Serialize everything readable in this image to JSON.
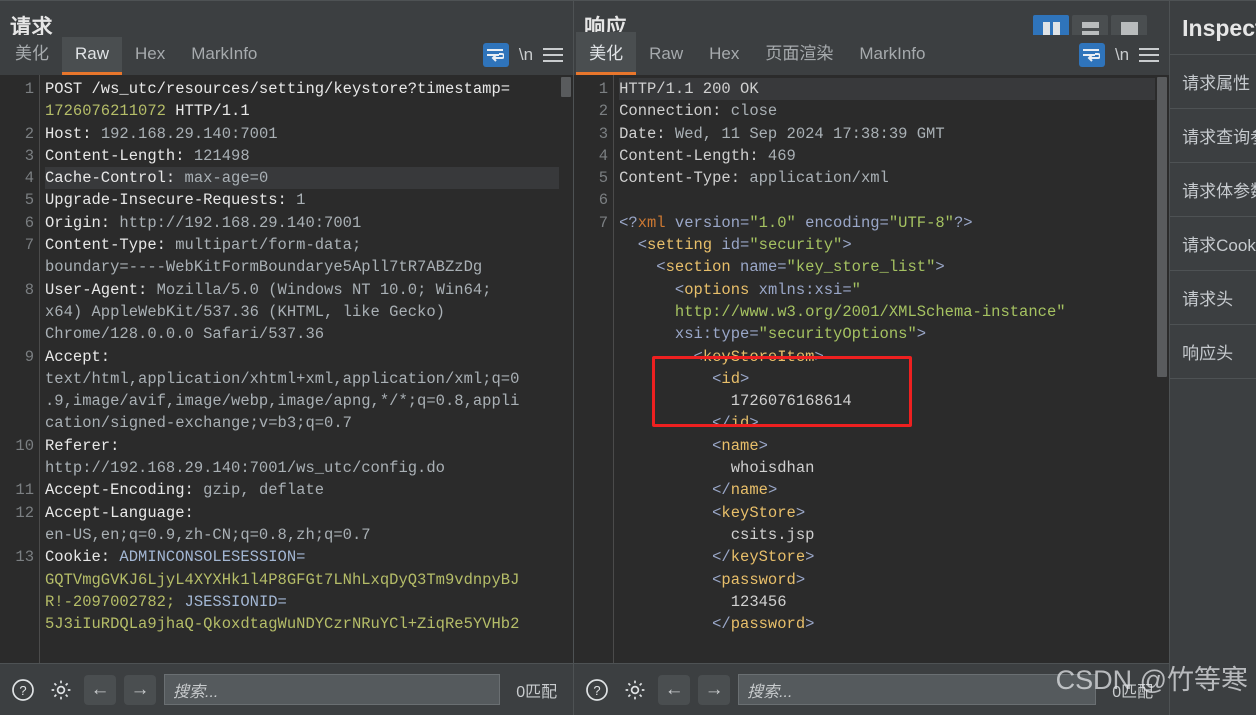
{
  "request": {
    "title": "请求",
    "tabs": [
      {
        "label": "美化",
        "active": false
      },
      {
        "label": "Raw",
        "active": true
      },
      {
        "label": "Hex",
        "active": false
      },
      {
        "label": "MarkInfo",
        "active": false
      }
    ],
    "tools": {
      "wrap": "word-wrap",
      "newline": "\\n",
      "menu": "menu"
    },
    "lines": [
      {
        "n": "1",
        "parts": [
          {
            "t": "POST /ws_utc/resources/setting/keystore?timestamp=",
            "c": "t-key"
          }
        ]
      },
      {
        "n": "",
        "parts": [
          {
            "t": "1726076211072",
            "c": "t-olive"
          },
          {
            "t": " HTTP/1.1",
            "c": "t-key"
          }
        ]
      },
      {
        "n": "2",
        "parts": [
          {
            "t": "Host: ",
            "c": "t-key"
          },
          {
            "t": "192.168.29.140:7001",
            "c": "t-val"
          }
        ]
      },
      {
        "n": "3",
        "parts": [
          {
            "t": "Content-Length: ",
            "c": "t-key"
          },
          {
            "t": "121498",
            "c": "t-val"
          }
        ]
      },
      {
        "n": "4",
        "hl": true,
        "parts": [
          {
            "t": "Cache-Control: ",
            "c": "t-key"
          },
          {
            "t": "max-age=0",
            "c": "t-val"
          }
        ]
      },
      {
        "n": "5",
        "parts": [
          {
            "t": "Upgrade-Insecure-Requests: ",
            "c": "t-key"
          },
          {
            "t": "1",
            "c": "t-val"
          }
        ]
      },
      {
        "n": "6",
        "parts": [
          {
            "t": "Origin: ",
            "c": "t-key"
          },
          {
            "t": "http://192.168.29.140:7001",
            "c": "t-val"
          }
        ]
      },
      {
        "n": "7",
        "parts": [
          {
            "t": "Content-Type: ",
            "c": "t-key"
          },
          {
            "t": "multipart/form-data;",
            "c": "t-val"
          }
        ]
      },
      {
        "n": "",
        "parts": [
          {
            "t": "boundary=----WebKitFormBoundarye5Apll7tR7ABZzDg",
            "c": "t-val"
          }
        ]
      },
      {
        "n": "8",
        "parts": [
          {
            "t": "User-Agent: ",
            "c": "t-key"
          },
          {
            "t": "Mozilla/5.0 (Windows NT 10.0; Win64;",
            "c": "t-val"
          }
        ]
      },
      {
        "n": "",
        "parts": [
          {
            "t": "x64) AppleWebKit/537.36 (KHTML, like Gecko)",
            "c": "t-val"
          }
        ]
      },
      {
        "n": "",
        "parts": [
          {
            "t": "Chrome/128.0.0.0 Safari/537.36",
            "c": "t-val"
          }
        ]
      },
      {
        "n": "9",
        "parts": [
          {
            "t": "Accept:",
            "c": "t-key"
          }
        ]
      },
      {
        "n": "",
        "parts": [
          {
            "t": "text/html,application/xhtml+xml,application/xml;q=0",
            "c": "t-val"
          }
        ]
      },
      {
        "n": "",
        "parts": [
          {
            "t": ".9,image/avif,image/webp,image/apng,*/*;q=0.8,appli",
            "c": "t-val"
          }
        ]
      },
      {
        "n": "",
        "parts": [
          {
            "t": "cation/signed-exchange;v=b3;q=0.7",
            "c": "t-val"
          }
        ]
      },
      {
        "n": "10",
        "parts": [
          {
            "t": "Referer:",
            "c": "t-key"
          }
        ]
      },
      {
        "n": "",
        "parts": [
          {
            "t": "http://192.168.29.140:7001/ws_utc/config.do",
            "c": "t-val"
          }
        ]
      },
      {
        "n": "11",
        "parts": [
          {
            "t": "Accept-Encoding: ",
            "c": "t-key"
          },
          {
            "t": "gzip, deflate",
            "c": "t-val"
          }
        ]
      },
      {
        "n": "12",
        "parts": [
          {
            "t": "Accept-Language:",
            "c": "t-key"
          }
        ]
      },
      {
        "n": "",
        "parts": [
          {
            "t": "en-US,en;q=0.9,zh-CN;q=0.8,zh;q=0.7",
            "c": "t-val"
          }
        ]
      },
      {
        "n": "13",
        "parts": [
          {
            "t": "Cookie: ",
            "c": "t-key"
          },
          {
            "t": "ADMINCONSOLESESSION=",
            "c": "t-blue"
          }
        ]
      },
      {
        "n": "",
        "parts": [
          {
            "t": "GQTVmgGVKJ6LjyL4XYXHk1l4P8GFGt7LNhLxqDyQ3Tm9vdnpyBJ",
            "c": "t-olive"
          }
        ]
      },
      {
        "n": "",
        "parts": [
          {
            "t": "R!-2097002782; ",
            "c": "t-olive"
          },
          {
            "t": "JSESSIONID=",
            "c": "t-blue"
          }
        ]
      },
      {
        "n": "",
        "parts": [
          {
            "t": "5J3iIuRDQLa9jhaQ-QkoxdtagWuNDYCzrNRuYCl+ZiqRe5YVHb2",
            "c": "t-olive"
          }
        ]
      }
    ],
    "findbar": {
      "help": "help-icon",
      "settings": "gear-icon",
      "prev": "←",
      "next": "→",
      "search_value": "",
      "search_placeholder": "搜索...",
      "match_count": "0匹配"
    }
  },
  "response": {
    "title": "响应",
    "tabs": [
      {
        "label": "美化",
        "active": true
      },
      {
        "label": "Raw",
        "active": false
      },
      {
        "label": "Hex",
        "active": false
      },
      {
        "label": "页面渲染",
        "active": false
      },
      {
        "label": "MarkInfo",
        "active": false
      }
    ],
    "tools": {
      "wrap": "word-wrap",
      "newline": "\\n",
      "menu": "menu"
    },
    "layout_toggles": [
      {
        "name": "vertical-split",
        "active": true
      },
      {
        "name": "horizontal-split",
        "active": false
      },
      {
        "name": "single-pane",
        "active": false
      }
    ],
    "lines": [
      {
        "n": "1",
        "hl": true,
        "parts": [
          {
            "t": "HTTP/1.1 200 OK",
            "c": "x-text"
          }
        ]
      },
      {
        "n": "2",
        "parts": [
          {
            "t": "Connection: ",
            "c": "x-text"
          },
          {
            "t": "close",
            "c": "t-val"
          }
        ]
      },
      {
        "n": "3",
        "parts": [
          {
            "t": "Date: ",
            "c": "x-text"
          },
          {
            "t": "Wed, 11 Sep 2024 17:38:39 GMT",
            "c": "t-val"
          }
        ]
      },
      {
        "n": "4",
        "parts": [
          {
            "t": "Content-Length: ",
            "c": "x-text"
          },
          {
            "t": "469",
            "c": "t-val"
          }
        ]
      },
      {
        "n": "5",
        "parts": [
          {
            "t": "Content-Type: ",
            "c": "x-text"
          },
          {
            "t": "application/xml",
            "c": "t-val"
          }
        ]
      },
      {
        "n": "6",
        "parts": [
          {
            "t": "",
            "c": "x-text"
          }
        ]
      },
      {
        "n": "7",
        "parts": [
          {
            "t": "<?",
            "c": "x-punct"
          },
          {
            "t": "xml",
            "c": "x-pi"
          },
          {
            "t": " version=",
            "c": "x-attr"
          },
          {
            "t": "\"1.0\"",
            "c": "x-str"
          },
          {
            "t": " encoding=",
            "c": "x-attr"
          },
          {
            "t": "\"UTF-8\"",
            "c": "x-str"
          },
          {
            "t": "?>",
            "c": "x-punct"
          }
        ]
      },
      {
        "n": "",
        "parts": [
          {
            "t": "  <",
            "c": "x-punct"
          },
          {
            "t": "setting",
            "c": "x-tag"
          },
          {
            "t": " id=",
            "c": "x-attr"
          },
          {
            "t": "\"security\"",
            "c": "x-str"
          },
          {
            "t": ">",
            "c": "x-punct"
          }
        ]
      },
      {
        "n": "",
        "parts": [
          {
            "t": "    <",
            "c": "x-punct"
          },
          {
            "t": "section",
            "c": "x-tag"
          },
          {
            "t": " name=",
            "c": "x-attr"
          },
          {
            "t": "\"key_store_list\"",
            "c": "x-str"
          },
          {
            "t": ">",
            "c": "x-punct"
          }
        ]
      },
      {
        "n": "",
        "parts": [
          {
            "t": "      <",
            "c": "x-punct"
          },
          {
            "t": "options",
            "c": "x-tag"
          },
          {
            "t": " xmlns:xsi=",
            "c": "x-attr"
          },
          {
            "t": "\"",
            "c": "x-str"
          }
        ]
      },
      {
        "n": "",
        "parts": [
          {
            "t": "      http://www.w3.org/2001/XMLSchema-instance\"",
            "c": "x-str"
          }
        ]
      },
      {
        "n": "",
        "parts": [
          {
            "t": "      xsi:type=",
            "c": "x-attr"
          },
          {
            "t": "\"securityOptions\"",
            "c": "x-str"
          },
          {
            "t": ">",
            "c": "x-punct"
          }
        ]
      },
      {
        "n": "",
        "parts": [
          {
            "t": "        <",
            "c": "x-punct"
          },
          {
            "t": "keyStoreItem",
            "c": "x-tag"
          },
          {
            "t": ">",
            "c": "x-punct"
          }
        ]
      },
      {
        "n": "",
        "parts": [
          {
            "t": "          <",
            "c": "x-punct"
          },
          {
            "t": "id",
            "c": "x-tag"
          },
          {
            "t": ">",
            "c": "x-punct"
          }
        ]
      },
      {
        "n": "",
        "parts": [
          {
            "t": "            1726076168614",
            "c": "x-text"
          }
        ]
      },
      {
        "n": "",
        "parts": [
          {
            "t": "          </",
            "c": "x-punct"
          },
          {
            "t": "id",
            "c": "x-tag"
          },
          {
            "t": ">",
            "c": "x-punct"
          }
        ]
      },
      {
        "n": "",
        "parts": [
          {
            "t": "          <",
            "c": "x-punct"
          },
          {
            "t": "name",
            "c": "x-tag"
          },
          {
            "t": ">",
            "c": "x-punct"
          }
        ]
      },
      {
        "n": "",
        "parts": [
          {
            "t": "            whoisdhan",
            "c": "x-text"
          }
        ]
      },
      {
        "n": "",
        "parts": [
          {
            "t": "          </",
            "c": "x-punct"
          },
          {
            "t": "name",
            "c": "x-tag"
          },
          {
            "t": ">",
            "c": "x-punct"
          }
        ]
      },
      {
        "n": "",
        "parts": [
          {
            "t": "          <",
            "c": "x-punct"
          },
          {
            "t": "keyStore",
            "c": "x-tag"
          },
          {
            "t": ">",
            "c": "x-punct"
          }
        ]
      },
      {
        "n": "",
        "parts": [
          {
            "t": "            csits.jsp",
            "c": "x-text"
          }
        ]
      },
      {
        "n": "",
        "parts": [
          {
            "t": "          </",
            "c": "x-punct"
          },
          {
            "t": "keyStore",
            "c": "x-tag"
          },
          {
            "t": ">",
            "c": "x-punct"
          }
        ]
      },
      {
        "n": "",
        "parts": [
          {
            "t": "          <",
            "c": "x-punct"
          },
          {
            "t": "password",
            "c": "x-tag"
          },
          {
            "t": ">",
            "c": "x-punct"
          }
        ]
      },
      {
        "n": "",
        "parts": [
          {
            "t": "            123456",
            "c": "x-text"
          }
        ]
      },
      {
        "n": "",
        "parts": [
          {
            "t": "          </",
            "c": "x-punct"
          },
          {
            "t": "password",
            "c": "x-tag"
          },
          {
            "t": ">",
            "c": "x-punct"
          }
        ]
      }
    ],
    "annotation": {
      "name": "id-highlight-box",
      "color": "#ee2020"
    },
    "findbar": {
      "help": "help-icon",
      "settings": "gear-icon",
      "prev": "←",
      "next": "→",
      "search_value": "",
      "search_placeholder": "搜索...",
      "match_count": "0匹配"
    }
  },
  "inspector": {
    "title": "Inspector",
    "items": [
      {
        "label": "请求属性"
      },
      {
        "label": "请求查询参数"
      },
      {
        "label": "请求体参数"
      },
      {
        "label": "请求Cookie"
      },
      {
        "label": "请求头"
      },
      {
        "label": "响应头"
      }
    ]
  },
  "watermark": "CSDN @竹等寒"
}
